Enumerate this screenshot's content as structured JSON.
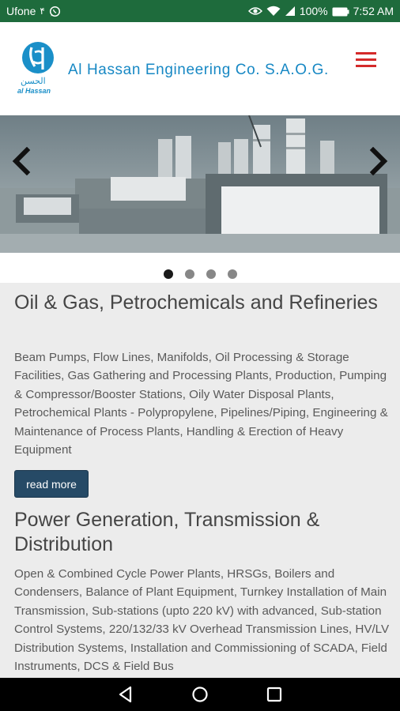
{
  "status_bar": {
    "carrier": "Ufone",
    "carrier_mark": "۴",
    "battery": "100%",
    "time": "7:52 AM",
    "left_icons": [
      "whatsapp-icon"
    ],
    "right_icons": [
      "eye-icon",
      "wifi-icon",
      "signal-icon",
      "battery-icon"
    ]
  },
  "header": {
    "logo_script": "الحسن",
    "logo_text": "al Hassan",
    "company_name": "Al Hassan Engineering Co. S.A.O.G.",
    "menu_icon": "hamburger-menu-icon"
  },
  "carousel": {
    "slides_total": 4,
    "active_index": 0,
    "prev_icon": "chevron-left-icon",
    "next_icon": "chevron-right-icon"
  },
  "sections": [
    {
      "title": "Oil & Gas, Petrochemicals and Refineries",
      "body": "Beam Pumps, Flow Lines, Manifolds, Oil Processing & Storage Facilities, Gas Gathering and Processing Plants, Production, Pumping & Compressor/Booster Stations, Oily Water Disposal Plants, Petrochemical Plants - Polypropylene, Pipelines/Piping, Engineering & Maintenance of Process Plants, Handling & Erection of Heavy Equipment",
      "button": "read more"
    },
    {
      "title": "Power Generation, Transmission & Distribution",
      "body": "Open & Combined Cycle Power Plants, HRSGs, Boilers and Condensers, Balance of Plant Equipment, Turnkey Installation of Main Transmission, Sub-stations (upto 220 kV) with advanced, Sub-station Control Systems, 220/132/33 kV Overhead Transmission Lines, HV/LV Distribution Systems, Installation and Commissioning of SCADA, Field Instruments, DCS & Field Bus"
    }
  ],
  "nav_bar": {
    "icons": [
      "back-triangle-icon",
      "home-circle-icon",
      "recents-square-icon"
    ]
  },
  "colors": {
    "status_bar": "#1e6b3c",
    "brand_blue": "#1788c4",
    "menu_red": "#d42a2a",
    "button": "#264a66",
    "page_bg": "#ececec"
  }
}
